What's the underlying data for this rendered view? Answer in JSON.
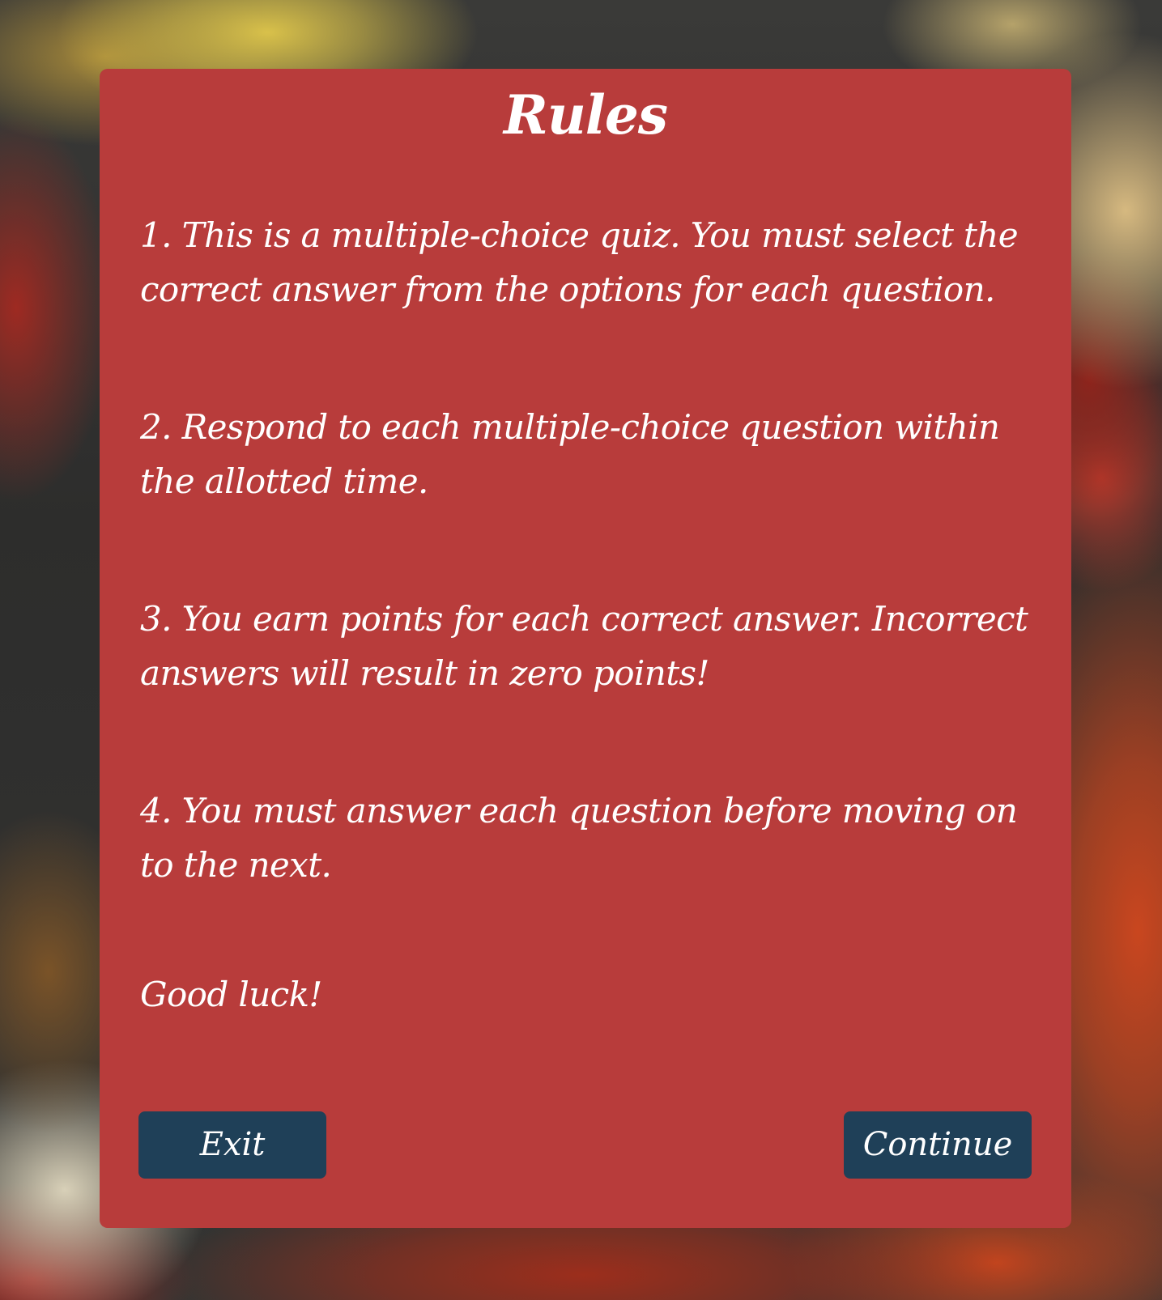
{
  "dialog": {
    "title": "Rules",
    "rules": [
      "1. This is a multiple-choice quiz. You must select the correct answer from the options for each question.",
      "2. Respond to each multiple-choice question within the allotted time.",
      "3. You earn points for each correct answer. Incorrect answers will result in zero points!",
      "4. You must answer each question before moving on to the next."
    ],
    "closing": "Good luck!",
    "exit_label": "Exit",
    "continue_label": "Continue"
  },
  "colors": {
    "card_background": "#b83c3b",
    "button_background": "#1f4058",
    "text": "#ffffff"
  }
}
